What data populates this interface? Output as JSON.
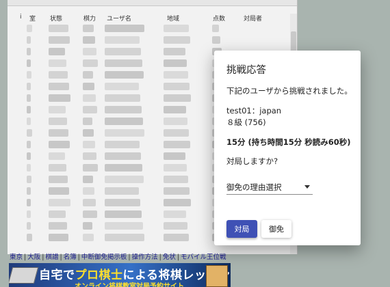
{
  "table": {
    "headers": [
      "i",
      "室",
      "状態",
      "棋力",
      "ユーザ名",
      "地域",
      "点数",
      "対局者"
    ]
  },
  "footer_links": [
    "東京",
    "大阪",
    "棋譜",
    "名簿",
    "中断御免掲示板",
    "操作方法",
    "免状",
    "モバイル王位戦"
  ],
  "banner": {
    "title_prefix": "自宅で",
    "title_accent": "プロ棋士",
    "title_suffix": "による将棋レッスン",
    "subtitle": "オンライン将棋教室対局予約サイト"
  },
  "dialog": {
    "title": "挑戦応答",
    "message": "下記のユーザから挑戦されました。",
    "user_line": "test01：japan",
    "rank_line": "８級 (756)",
    "time_control": "15分 (持ち時間15分 秒読み60秒)",
    "question": "対局しますか?",
    "decline_reason_select": "御免の理由選択",
    "accept_label": "対局",
    "decline_label": "御免"
  },
  "colors": {
    "primary": "#3f51b5",
    "background": "#a9b4af"
  }
}
